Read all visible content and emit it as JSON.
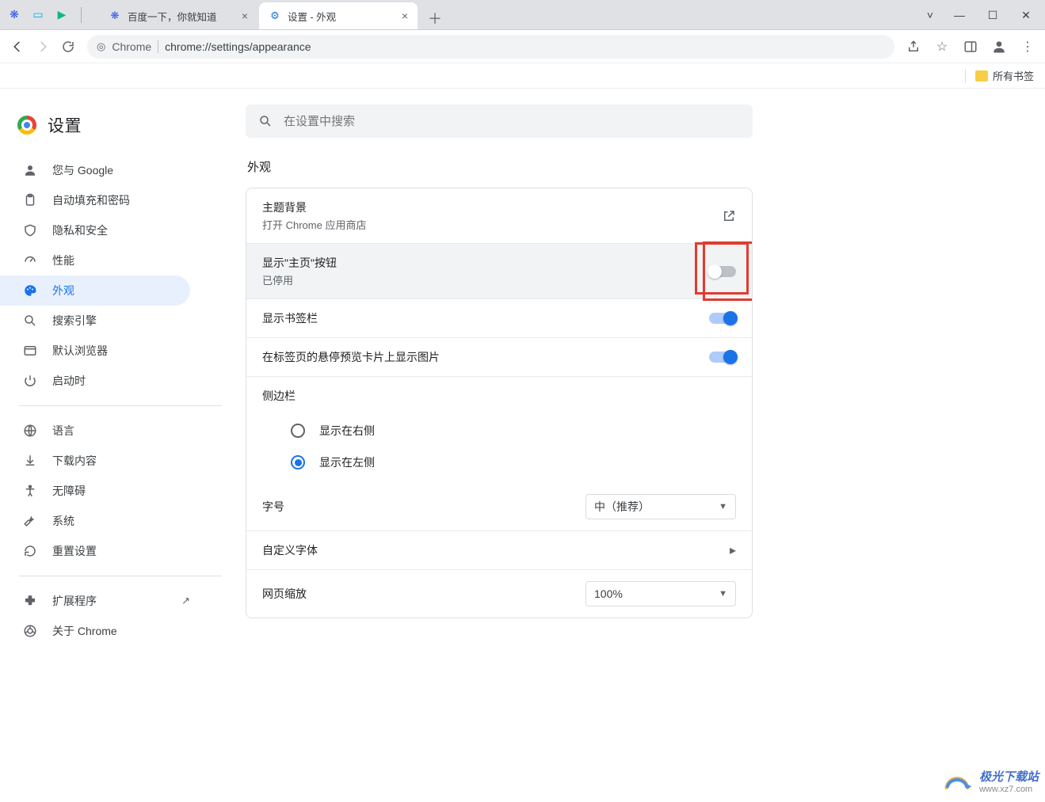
{
  "window": {
    "min": "–",
    "max": "▢",
    "close": "✕"
  },
  "title_icons": [
    "paw",
    "play",
    "video",
    "divider"
  ],
  "tabs": [
    {
      "title": "百度一下，你就知道",
      "icon": "baidu",
      "active": false
    },
    {
      "title": "设置 - 外观",
      "icon": "gear",
      "active": true
    }
  ],
  "omnibox": {
    "site_label": "Chrome",
    "url": "chrome://settings/appearance"
  },
  "bookmarks_bar": {
    "all_bookmarks": "所有书签"
  },
  "page_title": "设置",
  "search_placeholder": "在设置中搜索",
  "sidebar": {
    "items": [
      {
        "icon": "person",
        "label": "您与 Google"
      },
      {
        "icon": "clipboard",
        "label": "自动填充和密码"
      },
      {
        "icon": "shield",
        "label": "隐私和安全"
      },
      {
        "icon": "gauge",
        "label": "性能"
      },
      {
        "icon": "palette",
        "label": "外观",
        "active": true
      },
      {
        "icon": "search",
        "label": "搜索引擎"
      },
      {
        "icon": "browser",
        "label": "默认浏览器"
      },
      {
        "icon": "power",
        "label": "启动时"
      }
    ],
    "items2": [
      {
        "icon": "globe",
        "label": "语言"
      },
      {
        "icon": "download",
        "label": "下载内容"
      },
      {
        "icon": "accessibility",
        "label": "无障碍"
      },
      {
        "icon": "wrench",
        "label": "系统"
      },
      {
        "icon": "reset",
        "label": "重置设置"
      }
    ],
    "items3": [
      {
        "icon": "puzzle",
        "label": "扩展程序",
        "external": true
      },
      {
        "icon": "chrome",
        "label": "关于 Chrome"
      }
    ]
  },
  "section_title": "外观",
  "appearance": {
    "theme": {
      "title": "主题背景",
      "sub": "打开 Chrome 应用商店"
    },
    "show_home": {
      "title": "显示\"主页\"按钮",
      "sub": "已停用",
      "on": false
    },
    "show_bookmarks": {
      "title": "显示书签栏",
      "on": true
    },
    "hover_preview": {
      "title": "在标签页的悬停预览卡片上显示图片",
      "on": true
    },
    "sidepanel": {
      "title": "侧边栏",
      "option_right": "显示在右侧",
      "option_left": "显示在左侧",
      "selected": "left"
    },
    "font_size": {
      "title": "字号",
      "value": "中（推荐）"
    },
    "custom_fonts": {
      "title": "自定义字体"
    },
    "page_zoom": {
      "title": "网页缩放",
      "value": "100%"
    }
  },
  "watermark": {
    "line1": "极光下载站",
    "line2": "www.xz7.com"
  }
}
